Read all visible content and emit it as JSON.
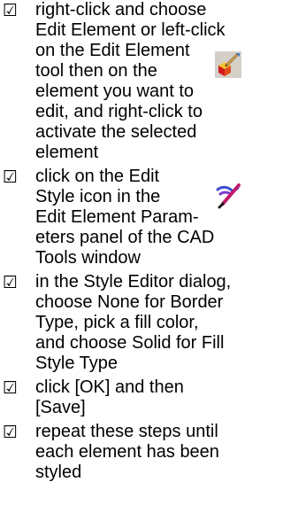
{
  "checkbox_glyph": "☑",
  "items": [
    {
      "text": "right-click and choose\nEdit Element or left-click\non the Edit Element\ntool then on the\nelement you want to\nedit, and right-click to\nactivate the selected\nelement"
    },
    {
      "text": "click on the Edit\nStyle icon in the\nEdit Element Param-\neters panel of the CAD\nTools window"
    },
    {
      "text": "in the Style Editor dialog,\nchoose None for Border\nType, pick a fill color,\nand choose Solid for Fill\nStyle Type"
    },
    {
      "text": "click [OK] and then\n[Save]"
    },
    {
      "text": "repeat these steps until\neach element has been\nstyled"
    }
  ],
  "icons": {
    "edit_element": "edit-element-tool-icon",
    "edit_style": "edit-style-icon"
  }
}
